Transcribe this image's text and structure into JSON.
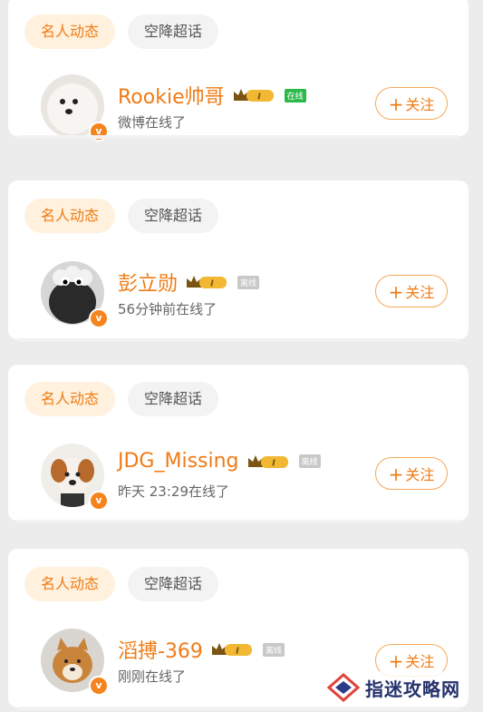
{
  "cards": [
    {
      "tab_active": "名人动态",
      "tab_other": "空降超话",
      "name": "Rookie帅哥",
      "level": "I",
      "status": "在线",
      "status_type": "online",
      "subline": "微博在线了",
      "follow_label": "关注",
      "avatar": "white-dog-avatar"
    },
    {
      "tab_active": "名人动态",
      "tab_other": "空降超话",
      "name": "彭立勋",
      "level": "I",
      "status": "离线",
      "status_type": "offline",
      "subline": "56分钟前在线了",
      "follow_label": "关注",
      "avatar": "sheep-plush-avatar"
    },
    {
      "tab_active": "名人动态",
      "tab_other": "空降超话",
      "name": "JDG_Missing",
      "level": "I",
      "status": "离线",
      "status_type": "offline",
      "subline": "昨天 23:29在线了",
      "follow_label": "关注",
      "avatar": "corgi-avatar"
    },
    {
      "tab_active": "名人动态",
      "tab_other": "空降超话",
      "name": "滔搏-369",
      "level": "I",
      "status": "离线",
      "status_type": "offline",
      "subline": "刚刚在线了",
      "follow_label": "关注",
      "avatar": "shiba-avatar"
    }
  ],
  "watermark": {
    "text": "指迷攻略网"
  },
  "colors": {
    "accent": "#f07b15",
    "tab_active_bg": "#fff1dd",
    "online": "#2bba4a"
  }
}
